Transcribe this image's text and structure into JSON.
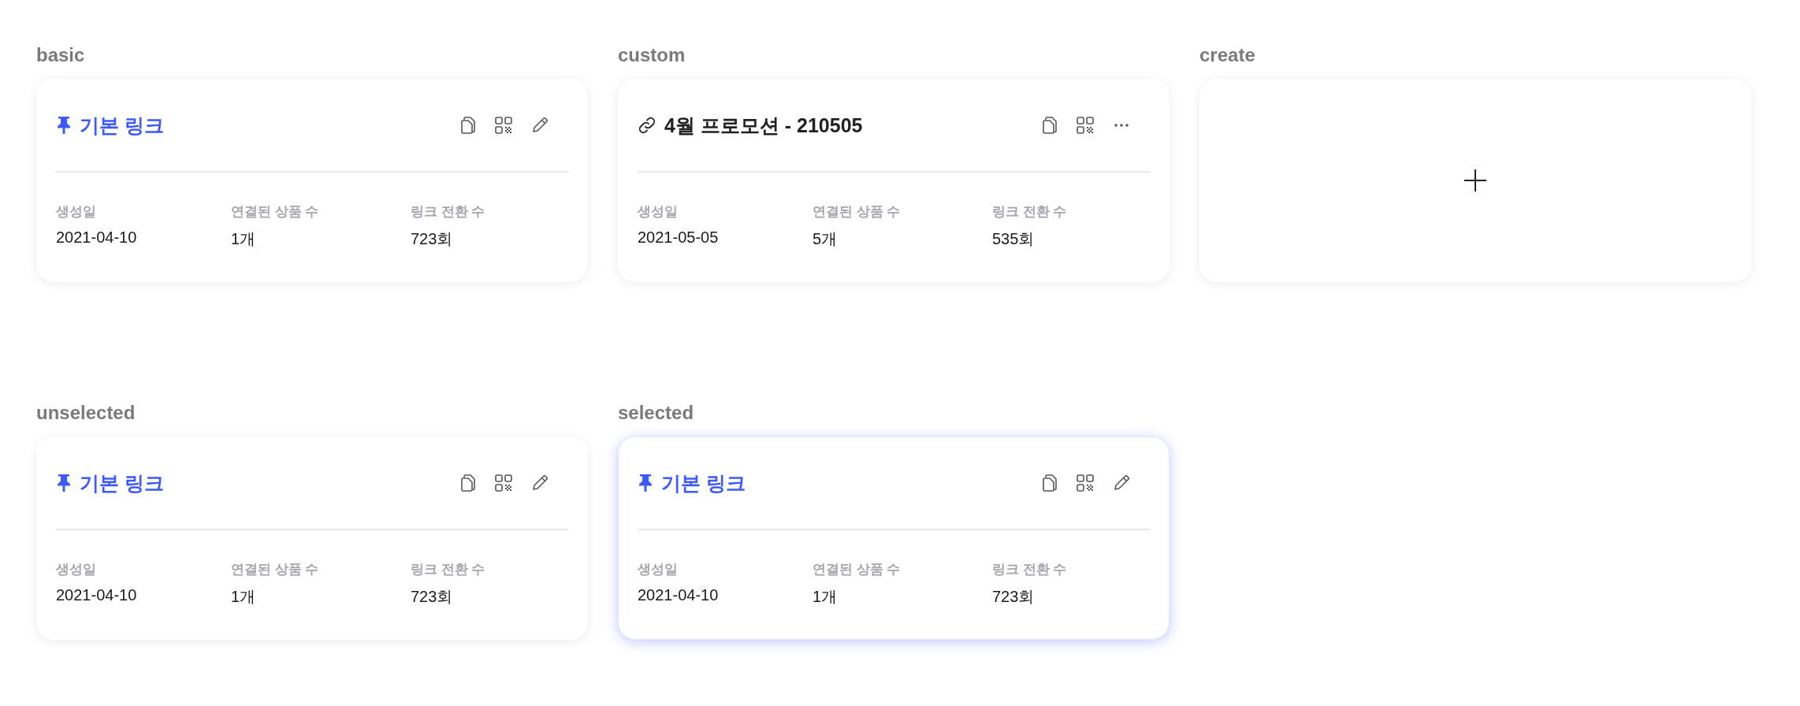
{
  "sections": [
    {
      "label": "basic",
      "kind": "link",
      "card": {
        "kind": "pinned",
        "selected": false,
        "title": "기본 링크",
        "stats": [
          {
            "label": "생성일",
            "value": "2021-04-10"
          },
          {
            "label": "연결된 상품 수",
            "value": "1개"
          },
          {
            "label": "링크 전환 수",
            "value": "723회"
          }
        ]
      }
    },
    {
      "label": "custom",
      "kind": "link",
      "card": {
        "kind": "custom",
        "selected": false,
        "title": "4월 프로모션 - 210505",
        "stats": [
          {
            "label": "생성일",
            "value": "2021-05-05"
          },
          {
            "label": "연결된 상품 수",
            "value": "5개"
          },
          {
            "label": "링크 전환 수",
            "value": "535회"
          }
        ]
      }
    },
    {
      "label": "create",
      "kind": "create"
    },
    {
      "label": "unselected",
      "kind": "link",
      "card": {
        "kind": "pinned",
        "selected": false,
        "title": "기본 링크",
        "stats": [
          {
            "label": "생성일",
            "value": "2021-04-10"
          },
          {
            "label": "연결된 상품 수",
            "value": "1개"
          },
          {
            "label": "링크 전환 수",
            "value": "723회"
          }
        ]
      }
    },
    {
      "label": "selected",
      "kind": "link",
      "card": {
        "kind": "pinned",
        "selected": true,
        "title": "기본 링크",
        "stats": [
          {
            "label": "생성일",
            "value": "2021-04-10"
          },
          {
            "label": "연결된 상품 수",
            "value": "1개"
          },
          {
            "label": "링크 전환 수",
            "value": "723회"
          }
        ]
      }
    }
  ]
}
